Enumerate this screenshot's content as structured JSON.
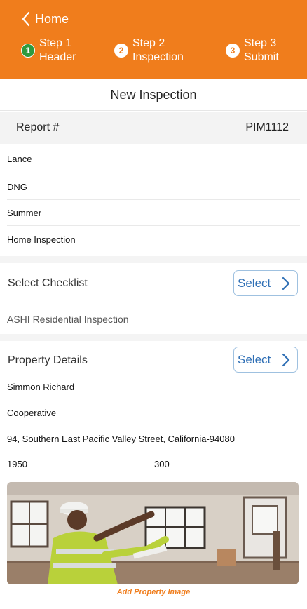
{
  "nav": {
    "back_label": "Home",
    "steps": [
      {
        "number": "1",
        "line1": "Step 1",
        "line2": "Header",
        "status": "active"
      },
      {
        "number": "2",
        "line1": "Step 2",
        "line2": "Inspection",
        "status": "pending"
      },
      {
        "number": "3",
        "line1": "Step 3",
        "line2": "Submit",
        "status": "pending"
      }
    ]
  },
  "page": {
    "title": "New Inspection"
  },
  "report": {
    "label": "Report #",
    "value": "PIM1112"
  },
  "fields": [
    "Lance",
    "DNG",
    "Summer",
    "Home Inspection"
  ],
  "checklist": {
    "label": "Select Checklist",
    "button_label": "Select",
    "selected": "ASHI Residential Inspection"
  },
  "property": {
    "label": "Property Details",
    "button_label": "Select",
    "owner": "Simmon Richard",
    "type": "Cooperative",
    "address": "94, Southern East Pacific Valley Street, California-94080",
    "year": "1950",
    "size": "300",
    "add_image_label": "Add Property Image"
  },
  "colors": {
    "header_bg": "#f07d1c",
    "active_step": "#2e9a3e",
    "link_blue": "#2f6fb5"
  }
}
